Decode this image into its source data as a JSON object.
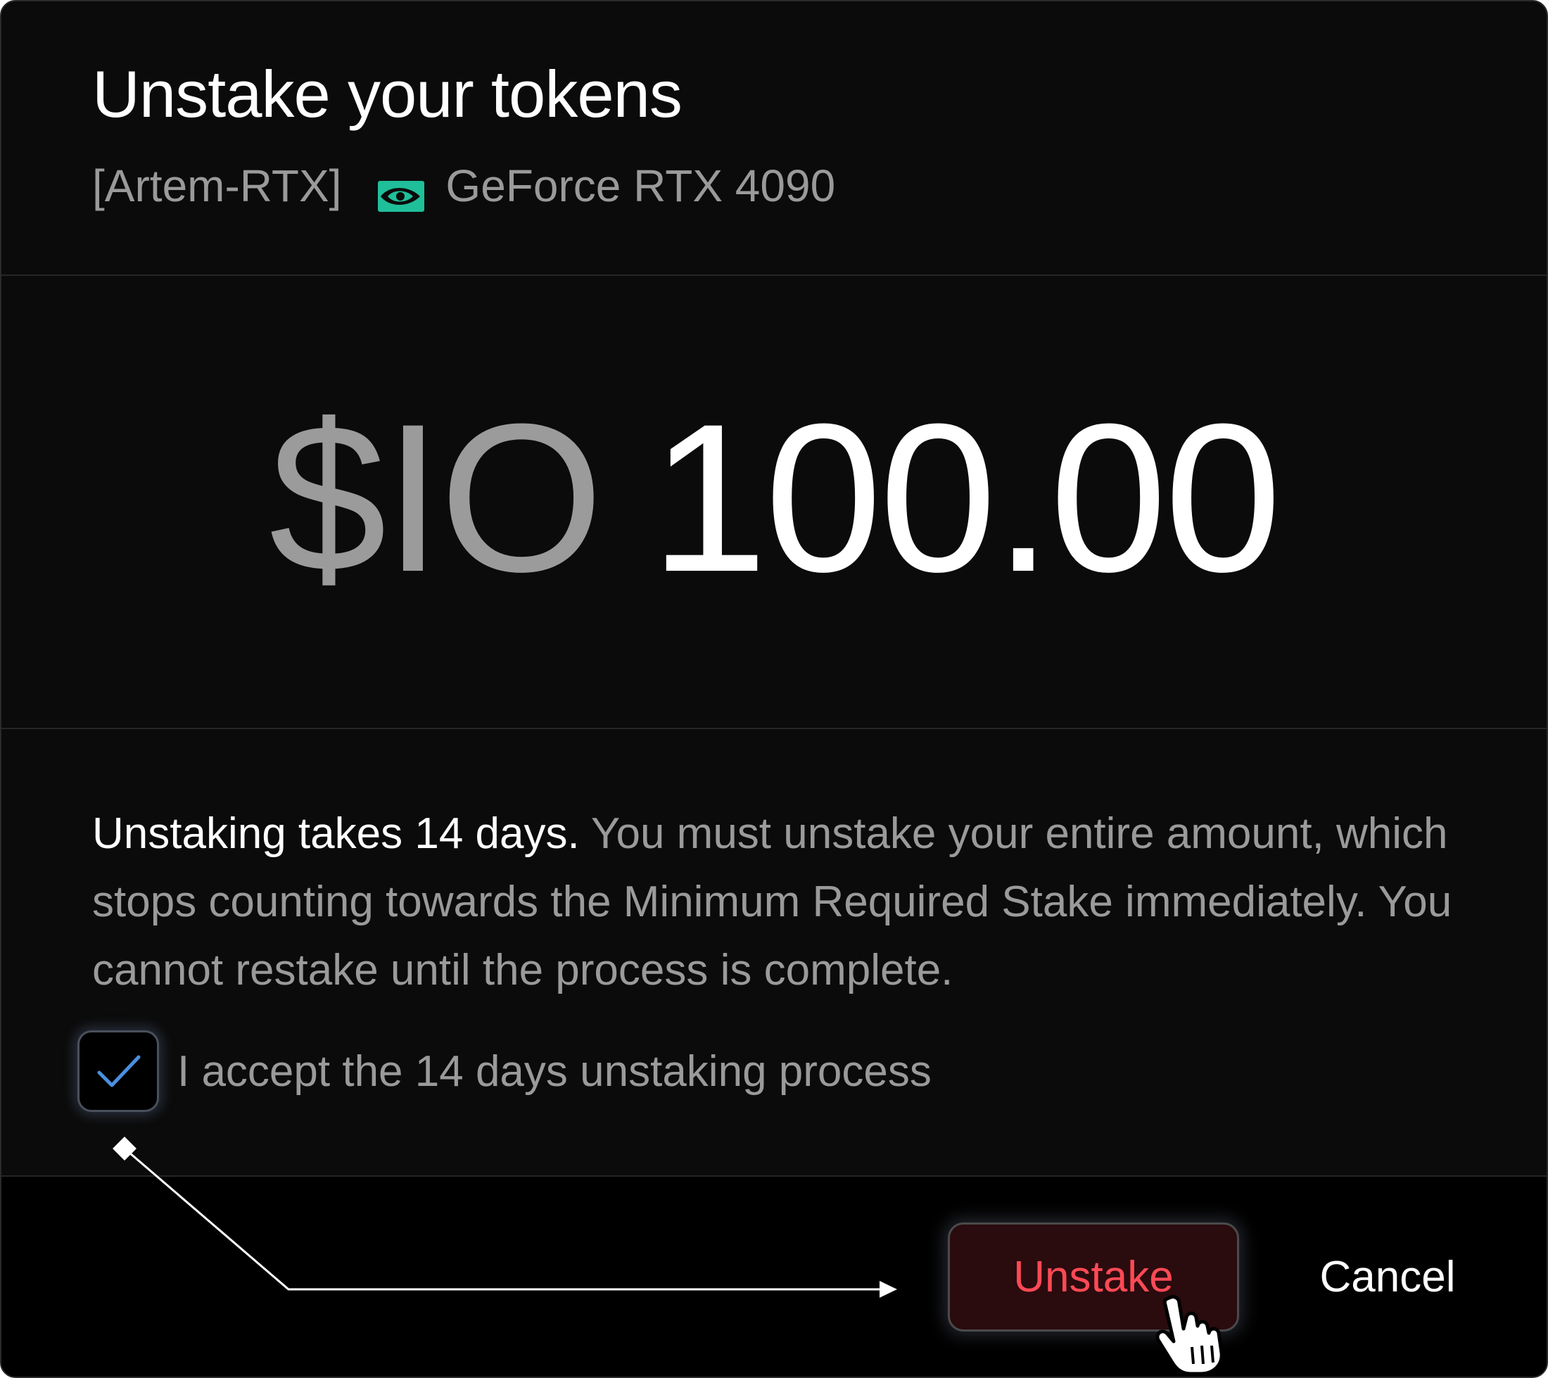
{
  "modal": {
    "title": "Unstake your tokens",
    "node_name": "[Artem-RTX]",
    "gpu_icon": "nvidia-logo-icon",
    "gpu_model": "GeForce RTX 4090"
  },
  "amount": {
    "currency": "$IO",
    "value": "100.00"
  },
  "info": {
    "lead": "Unstaking takes 14 days.",
    "body": " You must unstake your entire amount, which stops counting towards the Minimum Required Stake immediately. You cannot restake until the process is complete."
  },
  "acceptance": {
    "label": "I accept the 14 days unstaking process",
    "checked": true
  },
  "actions": {
    "unstake_label": "Unstake",
    "cancel_label": "Cancel"
  },
  "colors": {
    "background": "#0b0b0b",
    "accent_danger": "#ff4a55",
    "danger_button_bg": "#2a0b0e",
    "nvidia_green": "#1fbf9a",
    "checkmark_blue": "#4b8fe0"
  }
}
